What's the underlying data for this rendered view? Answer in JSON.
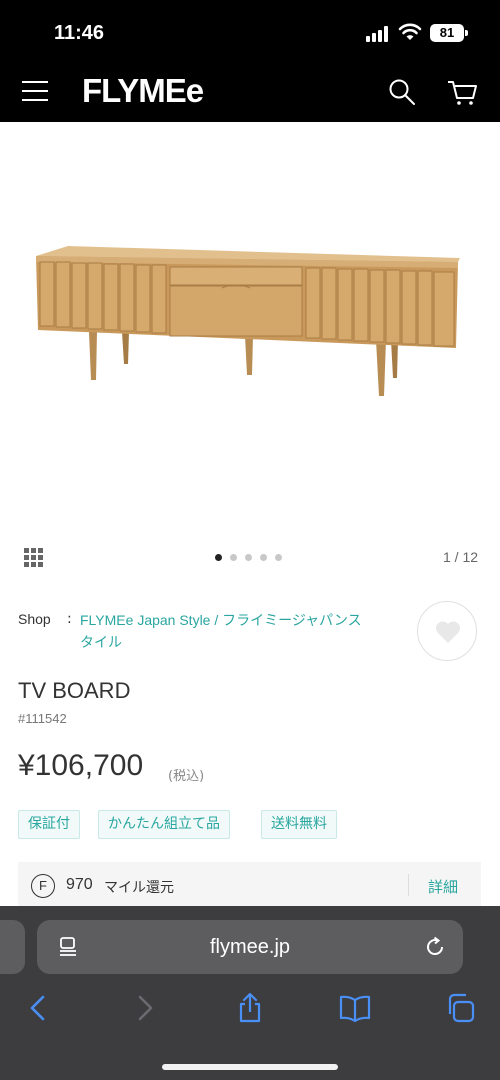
{
  "status_bar": {
    "time": "11:46",
    "battery": "81"
  },
  "header": {
    "logo": "FLYMEe"
  },
  "carousel": {
    "counter": "1 / 12",
    "dot_count": 5,
    "active_index": 0
  },
  "product": {
    "shop_label": "Shop",
    "shop_separator": ":",
    "shop_name": "FLYMEe Japan Style / フライミージャパンスタイル",
    "title": "TV BOARD",
    "sku": "#111542",
    "price": "¥106,700",
    "tax_note": "(税込)",
    "tags": [
      "保証付",
      "かんたん組立て品",
      "送料無料"
    ]
  },
  "miles": {
    "icon_letter": "F",
    "amount": "970",
    "label": "マイル還元",
    "detail_link": "詳細"
  },
  "browser": {
    "url": "flymee.jp"
  },
  "colors": {
    "accent": "#2aa6a0",
    "header_bg": "#000000",
    "browser_bg": "#3d3d40",
    "link_blue": "#4a8ff5"
  }
}
